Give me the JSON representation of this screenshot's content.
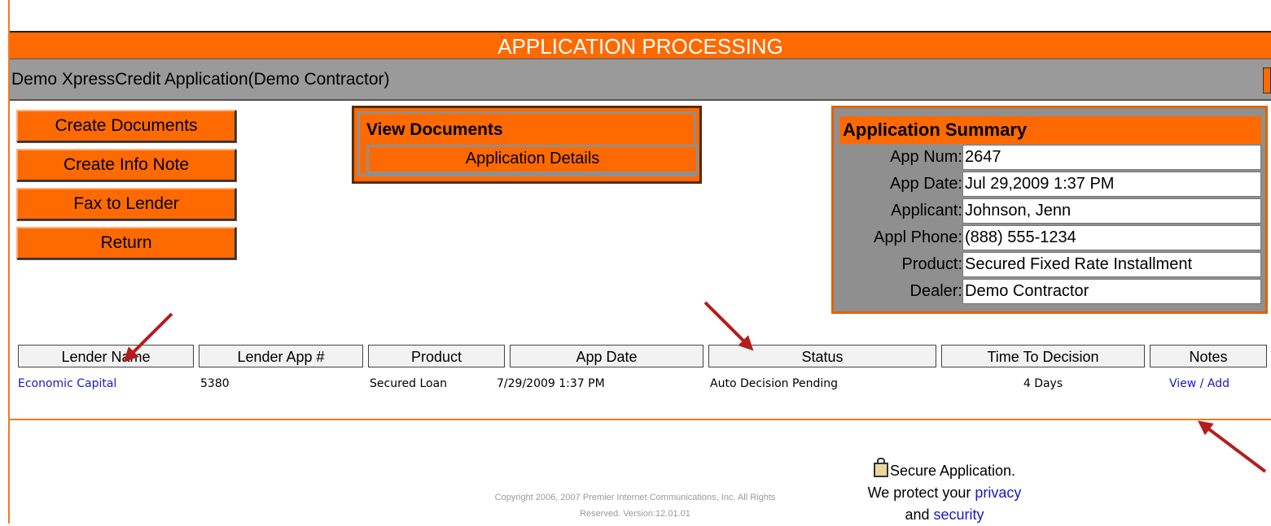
{
  "header": {
    "title": "APPLICATION PROCESSING",
    "subtitle": "Demo XpressCredit Application(Demo Contractor)"
  },
  "actions": {
    "create_documents": "Create Documents",
    "create_info_note": "Create Info Note",
    "fax_to_lender": "Fax to Lender",
    "return": "Return"
  },
  "view_documents": {
    "title": "View Documents",
    "application_details": "Application Details"
  },
  "summary": {
    "title": "Application Summary",
    "rows": [
      {
        "label": "App Num:",
        "value": "2647"
      },
      {
        "label": "App Date:",
        "value": "Jul 29,2009 1:37 PM"
      },
      {
        "label": "Applicant:",
        "value": "Johnson, Jenn"
      },
      {
        "label": "Appl Phone:",
        "value": "(888) 555-1234"
      },
      {
        "label": "Product:",
        "value": "Secured Fixed Rate Installment"
      },
      {
        "label": "Dealer:",
        "value": "Demo Contractor"
      }
    ]
  },
  "lender_table": {
    "headers": [
      "Lender Name",
      "Lender App #",
      "Product",
      "App Date",
      "Status",
      "Time To Decision",
      "Notes"
    ],
    "rows": [
      {
        "lender_name": "Economic Capital",
        "lender_app_num": "5380",
        "product": "Secured Loan",
        "app_date": "7/29/2009 1:37 PM",
        "status": "Auto Decision Pending",
        "time_to_decision": "4 Days",
        "notes_view": "View",
        "notes_sep": " / ",
        "notes_add": "Add"
      }
    ]
  },
  "footer": {
    "copyright_line1": "Copyright 2006, 2007 Premier Internet Communications, Inc. All Rights",
    "copyright_line2": "Reserved. Version:12.01.01",
    "secure_line1": "Secure Application.",
    "secure_line2_prefix": "We protect your ",
    "privacy_link": "privacy",
    "secure_line3_prefix": "and ",
    "security_link": "security"
  },
  "colors": {
    "accent_orange": "#ff6a00",
    "bar_gray": "#9a9a9a",
    "link_blue": "#1818c8",
    "annotation_red": "#b51d1d"
  }
}
